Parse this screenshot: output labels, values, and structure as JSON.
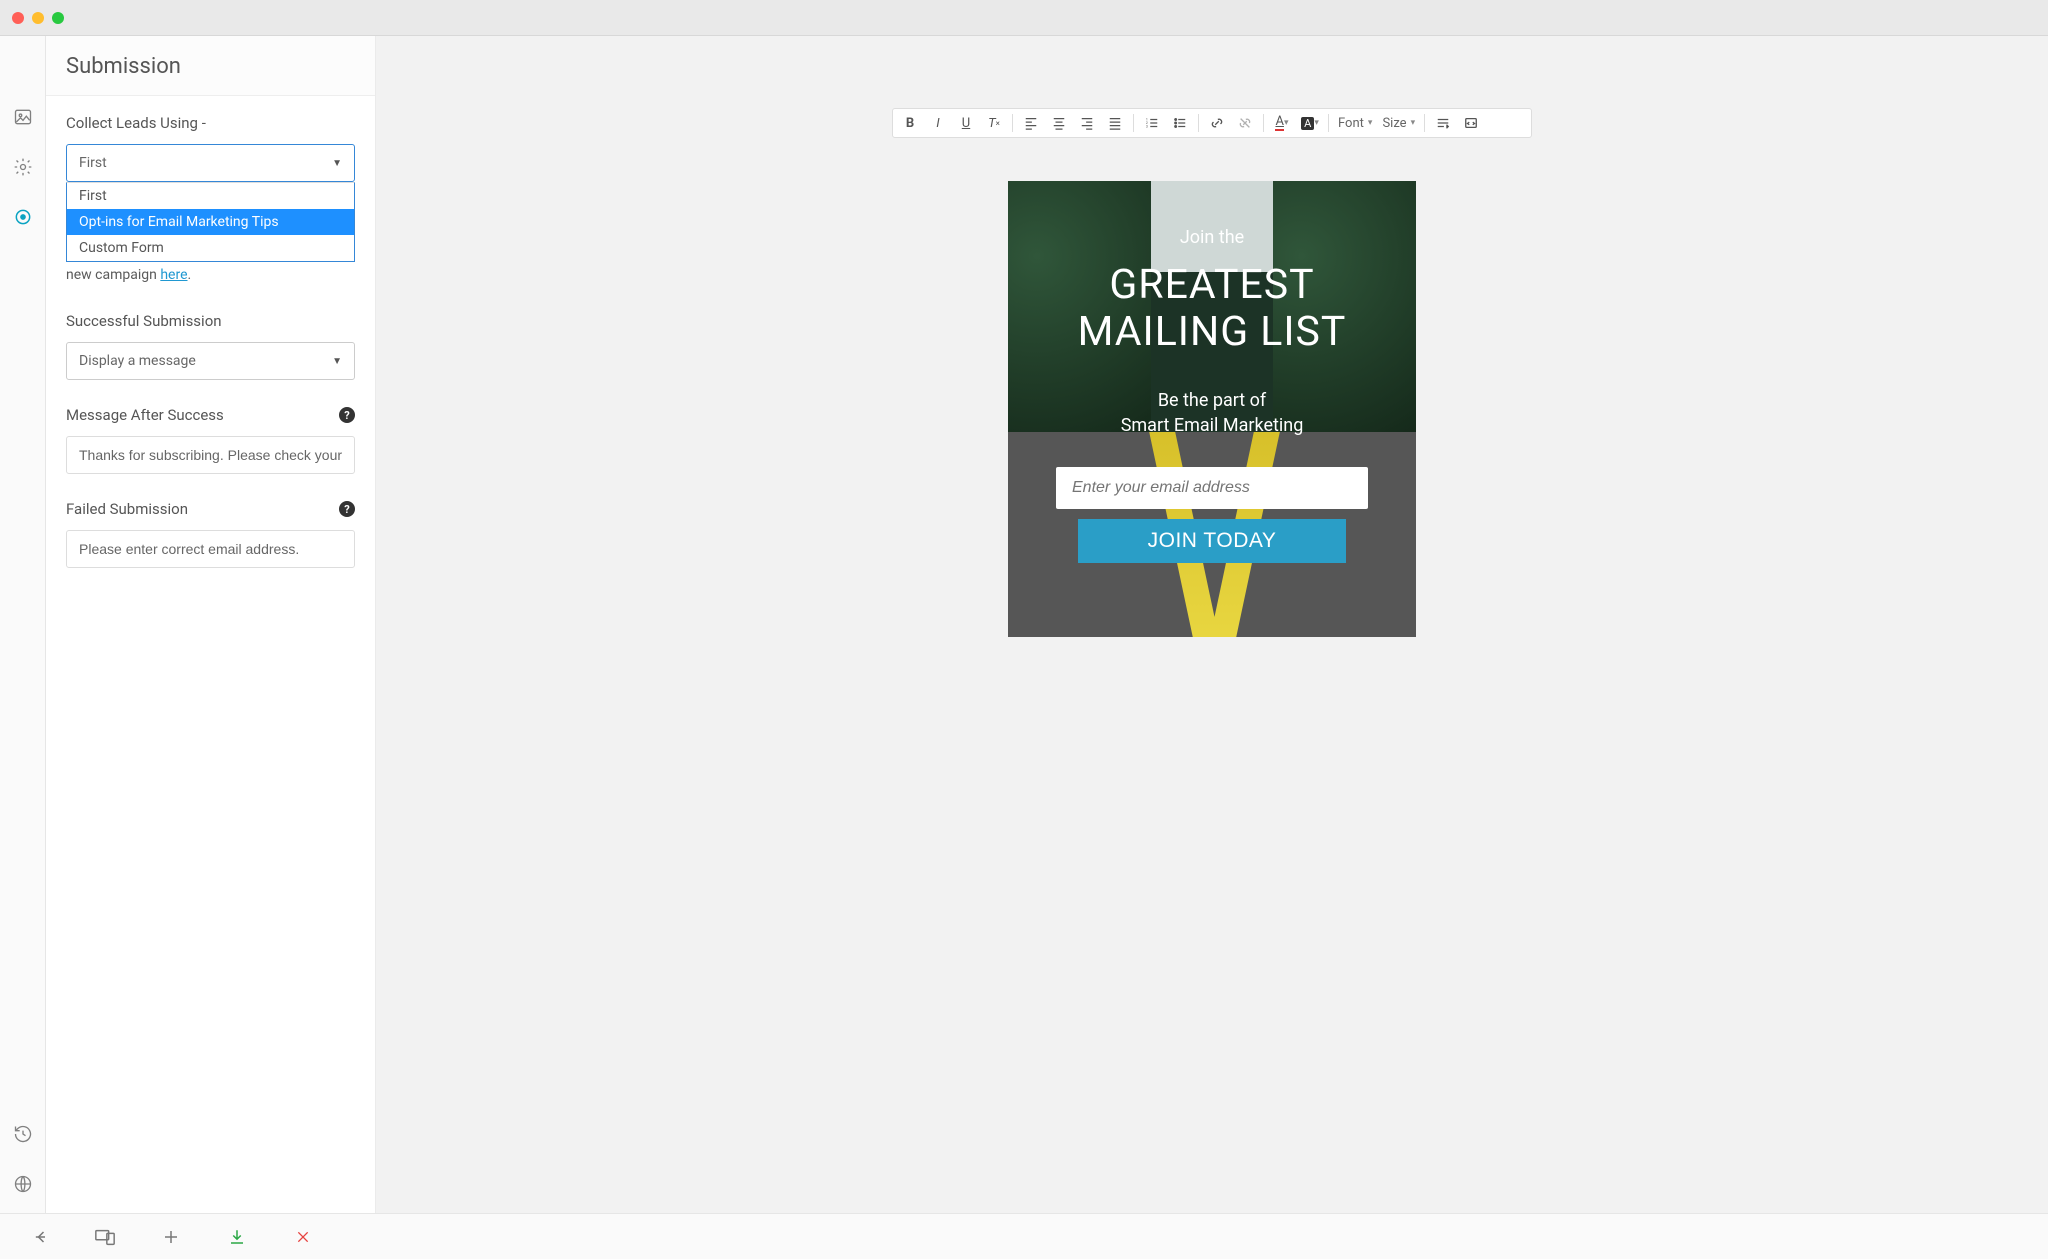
{
  "panel": {
    "title": "Submission",
    "collect_label": "Collect Leads Using -",
    "collect_selected": "First",
    "collect_options": [
      "First",
      "Opt-ins for Email Marketing Tips",
      "Custom Form"
    ],
    "collect_hint_prefix": "campaign. If you would like, you can create a new campaign ",
    "collect_hint_link": "here",
    "collect_hint_suffix": ".",
    "success_label": "Successful Submission",
    "success_selected": "Display a message",
    "msg_label": "Message After Success",
    "msg_value": "Thanks for subscribing. Please check your",
    "fail_label": "Failed Submission",
    "fail_value": "Please enter correct email address."
  },
  "toolbar": {
    "font_label": "Font",
    "size_label": "Size"
  },
  "card": {
    "pretitle": "Join the",
    "title_line1": "GREATEST",
    "title_line2": "MAILING LIST",
    "sub_line1": "Be the part of",
    "sub_line2": "Smart Email Marketing",
    "email_placeholder": "Enter your email address",
    "button": "JOIN TODAY"
  }
}
